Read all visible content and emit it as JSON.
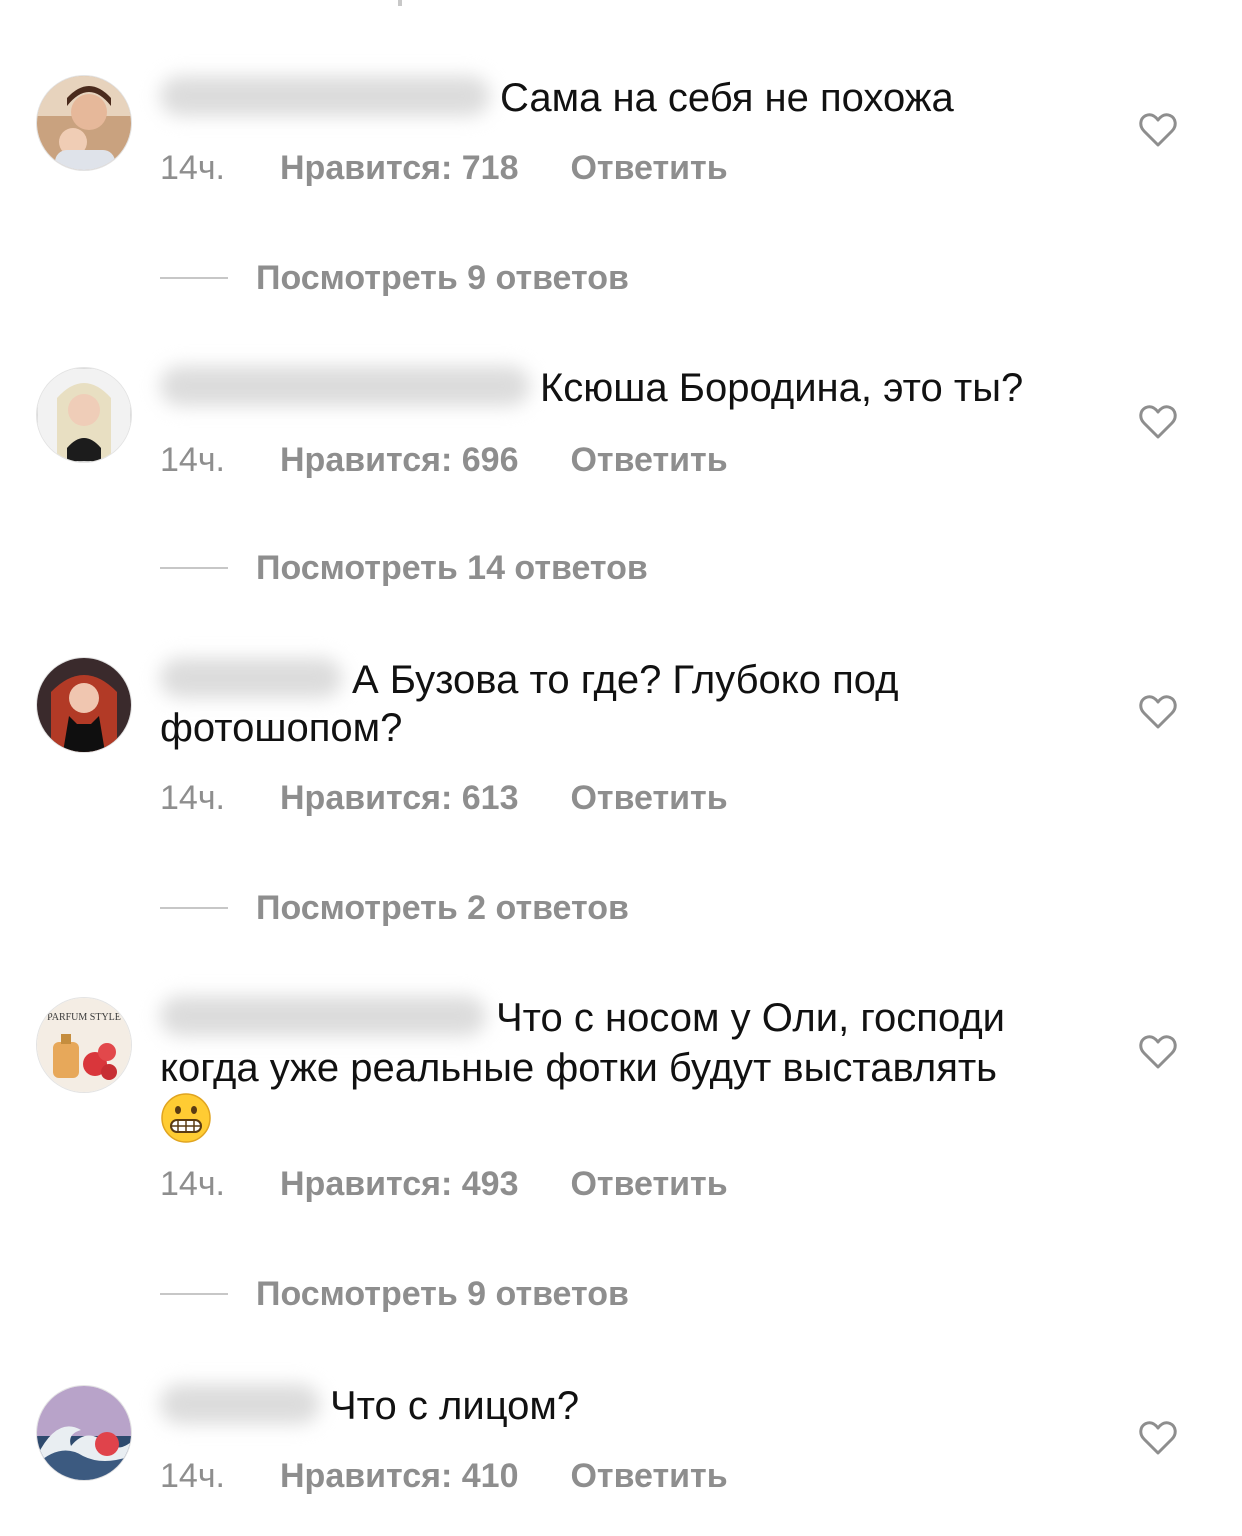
{
  "comments": [
    {
      "text": "Сама на себя не похожа",
      "time": "14ч.",
      "likes": "Нравится: 718",
      "reply": "Ответить",
      "view_replies": "Посмотреть 9 ответов"
    },
    {
      "text": "Ксюша Бородина, это ты?",
      "time": "14ч.",
      "likes": "Нравится: 696",
      "reply": "Ответить",
      "view_replies": "Посмотреть 14 ответов"
    },
    {
      "text_line1": "А Бузова то где? Глубоко под",
      "text_line2": "фотошопом?",
      "time": "14ч.",
      "likes": "Нравится: 613",
      "reply": "Ответить",
      "view_replies": "Посмотреть 2 ответов"
    },
    {
      "avatar_text": "PARFUM STYLE",
      "text_line1": "Что с носом у Оли, господи",
      "text_line2": "когда уже реальные фотки будут выставлять",
      "time": "14ч.",
      "likes": "Нравится: 493",
      "reply": "Ответить",
      "view_replies": "Посмотреть 9 ответов"
    },
    {
      "text": "Что с лицом?",
      "time": "14ч.",
      "likes": "Нравится: 410",
      "reply": "Ответить"
    }
  ],
  "icons": {
    "like": "heart-outline-icon",
    "emoji": "grimacing-face-emoji"
  },
  "colors": {
    "text": "#111111",
    "meta": "#8e8e8e",
    "divider": "#c7c7c7"
  }
}
